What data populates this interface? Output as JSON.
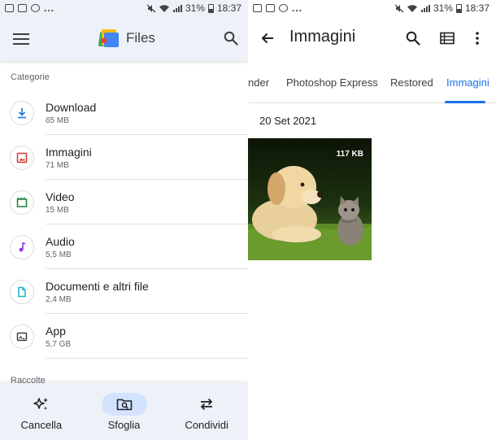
{
  "left": {
    "status_bar": {
      "battery": "31%",
      "time": "18:37",
      "dots": "..."
    },
    "app_title": "Files",
    "sections": {
      "categories": "Categorie",
      "collections": "Raccolte"
    },
    "categories": [
      {
        "name": "Download",
        "size": "65 MB",
        "icon": "download-icon",
        "color": "#1a73e8"
      },
      {
        "name": "Immagini",
        "size": "71 MB",
        "icon": "image-icon",
        "color": "#d93025"
      },
      {
        "name": "Video",
        "size": "15 MB",
        "icon": "video-icon",
        "color": "#188038"
      },
      {
        "name": "Audio",
        "size": "5,5 MB",
        "icon": "music-note-icon",
        "color": "#9334e6"
      },
      {
        "name": "Documenti e altri file",
        "size": "2,4 MB",
        "icon": "document-icon",
        "color": "#12b5cb"
      },
      {
        "name": "App",
        "size": "5,7 GB",
        "icon": "app-icon",
        "color": "#3c4043"
      }
    ],
    "bottom_nav": [
      {
        "label": "Cancella",
        "icon": "sparkle-icon",
        "active": false
      },
      {
        "label": "Sfoglia",
        "icon": "browse-icon",
        "active": true
      },
      {
        "label": "Condividi",
        "icon": "swap-icon",
        "active": false
      }
    ]
  },
  "right": {
    "status_bar": {
      "battery": "31%",
      "time": "18:37",
      "dots": "..."
    },
    "title": "Immagini",
    "tabs": [
      "nder",
      "Photoshop Express",
      "Restored",
      "Immagini"
    ],
    "active_tab": "Immagini",
    "date_header": "20 Set 2021",
    "thumbnail": {
      "size_label": "117 KB"
    }
  },
  "colors": {
    "accent": "#1a73e8",
    "appbar_bg": "#eef2f8",
    "active_pill": "#d3e3fd"
  }
}
